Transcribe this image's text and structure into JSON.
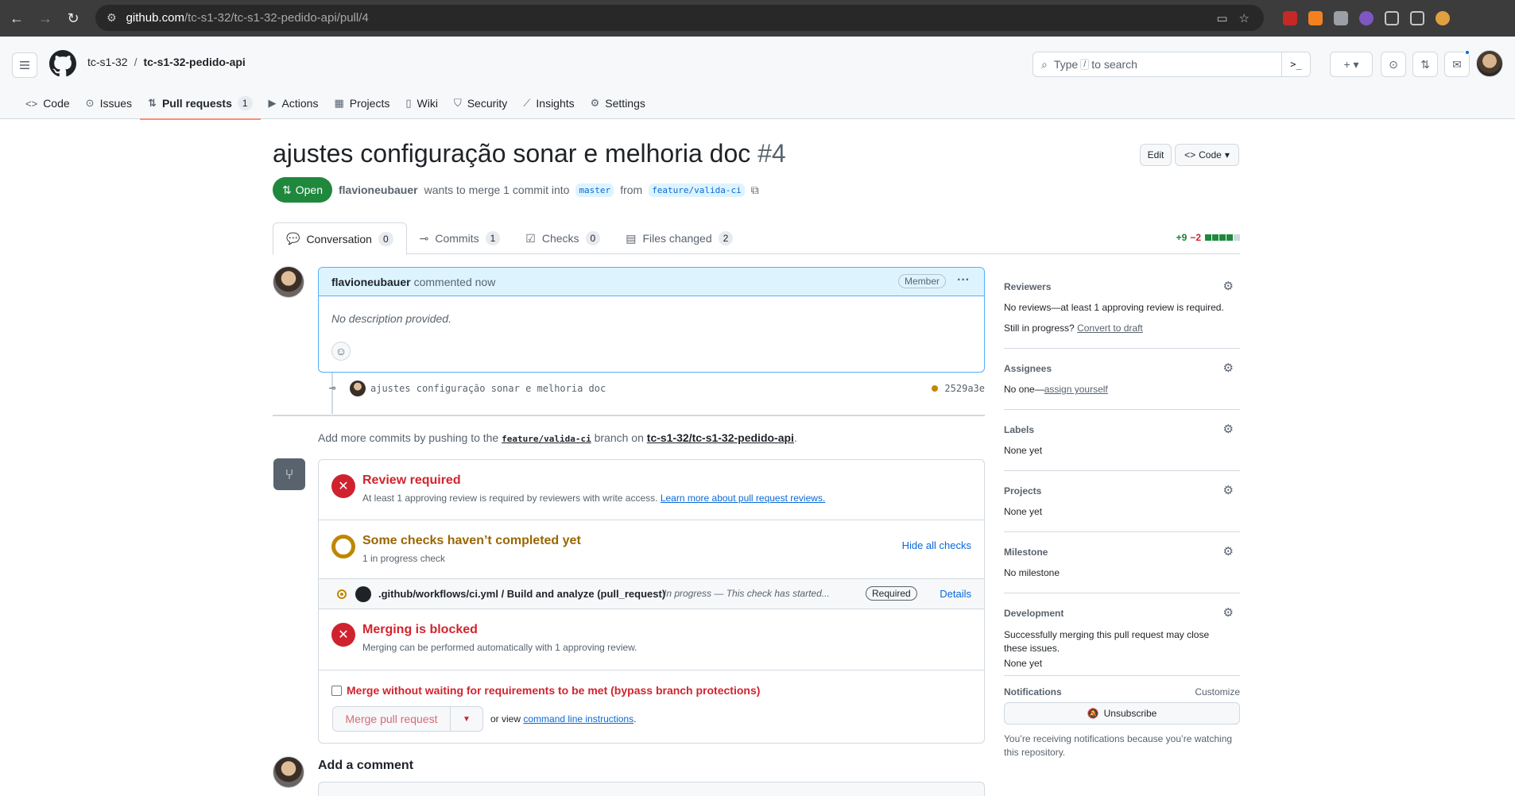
{
  "browser": {
    "url_host": "github.com",
    "url_path": "/tc-s1-32/tc-s1-32-pedido-api/pull/4"
  },
  "header": {
    "owner": "tc-s1-32",
    "separator": "/",
    "repo": "tc-s1-32-pedido-api",
    "search_prefix": "Type",
    "search_key": "/",
    "search_suffix": "to search",
    "plus_label": "+",
    "cmd_label": ">_"
  },
  "repo_nav": [
    {
      "label": "Code",
      "icon": "code-icon"
    },
    {
      "label": "Issues",
      "icon": "issue-icon"
    },
    {
      "label": "Pull requests",
      "icon": "pull-request-icon",
      "count": "1",
      "active": true
    },
    {
      "label": "Actions",
      "icon": "play-icon"
    },
    {
      "label": "Projects",
      "icon": "table-icon"
    },
    {
      "label": "Wiki",
      "icon": "book-icon"
    },
    {
      "label": "Security",
      "icon": "shield-icon"
    },
    {
      "label": "Insights",
      "icon": "graph-icon"
    },
    {
      "label": "Settings",
      "icon": "gear-icon"
    }
  ],
  "pr": {
    "title": "ajustes configuração sonar e melhoria doc",
    "number": "#4",
    "edit_label": "Edit",
    "code_label": "Code",
    "state": "Open",
    "author": "flavioneubauer",
    "merge_text": "wants to merge 1 commit into",
    "base_branch": "master",
    "from_text": "from",
    "head_branch": "feature/valida-ci"
  },
  "pr_tabs": [
    {
      "label": "Conversation",
      "count": "0",
      "active": true
    },
    {
      "label": "Commits",
      "count": "1"
    },
    {
      "label": "Checks",
      "count": "0"
    },
    {
      "label": "Files changed",
      "count": "2"
    }
  ],
  "diffstat": {
    "additions": "+9",
    "deletions": "−2",
    "blocks_green": 4,
    "blocks_total": 5
  },
  "comment": {
    "author": "flavioneubauer",
    "action": "commented now",
    "role": "Member",
    "body": "No description provided."
  },
  "commit": {
    "message": "ajustes configuração sonar e melhoria doc",
    "sha": "2529a3e"
  },
  "push_hint": {
    "prefix": "Add more commits by pushing to the",
    "branch": "feature/valida-ci",
    "middle": "branch on",
    "repo": "tc-s1-32/tc-s1-32-pedido-api",
    "suffix": "."
  },
  "merge_box": {
    "review_title": "Review required",
    "review_sub": "At least 1 approving review is required by reviewers with write access.",
    "review_link": "Learn more about pull request reviews.",
    "checks_title": "Some checks haven’t completed yet",
    "checks_sub": "1 in progress check",
    "hide_checks": "Hide all checks",
    "check_name": ".github/workflows/ci.yml / Build and analyze (pull_request)",
    "check_status": "In progress — This check has started...",
    "check_required": "Required",
    "check_details": "Details",
    "blocked_title": "Merging is blocked",
    "blocked_sub": "Merging can be performed automatically with 1 approving review.",
    "bypass_label": "Merge without waiting for requirements to be met (bypass branch protections)",
    "merge_button": "Merge pull request",
    "or_view": "or view",
    "cli_link": "command line instructions",
    "cli_suffix": "."
  },
  "add_comment": "Add a comment",
  "sidebar": {
    "reviewers_head": "Reviewers",
    "reviewers_text": "No reviews—at least 1 approving review is required.",
    "reviewers_progress": "Still in progress?",
    "convert_draft": "Convert to draft",
    "assignees_head": "Assignees",
    "assignees_text": "No one—",
    "assign_yourself": "assign yourself",
    "labels_head": "Labels",
    "labels_text": "None yet",
    "projects_head": "Projects",
    "projects_text": "None yet",
    "milestone_head": "Milestone",
    "milestone_text": "No milestone",
    "development_head": "Development",
    "development_text": "Successfully merging this pull request may close these issues.",
    "development_none": "None yet",
    "notifications_head": "Notifications",
    "customize": "Customize",
    "unsubscribe": "Unsubscribe",
    "notif_reason": "You’re receiving notifications because you’re watching this repository."
  }
}
